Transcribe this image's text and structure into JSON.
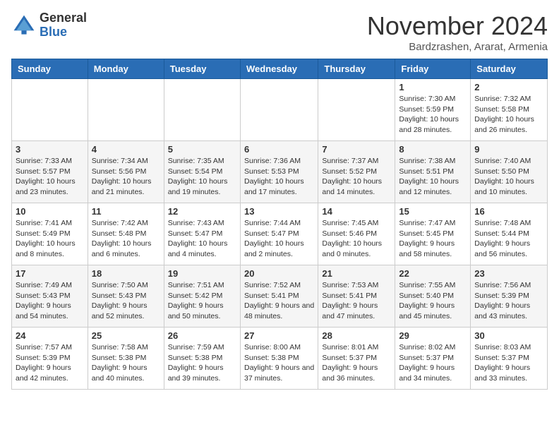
{
  "header": {
    "logo_general": "General",
    "logo_blue": "Blue",
    "month_title": "November 2024",
    "subtitle": "Bardzrashen, Ararat, Armenia"
  },
  "days_of_week": [
    "Sunday",
    "Monday",
    "Tuesday",
    "Wednesday",
    "Thursday",
    "Friday",
    "Saturday"
  ],
  "weeks": [
    [
      {
        "day": "",
        "info": ""
      },
      {
        "day": "",
        "info": ""
      },
      {
        "day": "",
        "info": ""
      },
      {
        "day": "",
        "info": ""
      },
      {
        "day": "",
        "info": ""
      },
      {
        "day": "1",
        "info": "Sunrise: 7:30 AM\nSunset: 5:59 PM\nDaylight: 10 hours and 28 minutes."
      },
      {
        "day": "2",
        "info": "Sunrise: 7:32 AM\nSunset: 5:58 PM\nDaylight: 10 hours and 26 minutes."
      }
    ],
    [
      {
        "day": "3",
        "info": "Sunrise: 7:33 AM\nSunset: 5:57 PM\nDaylight: 10 hours and 23 minutes."
      },
      {
        "day": "4",
        "info": "Sunrise: 7:34 AM\nSunset: 5:56 PM\nDaylight: 10 hours and 21 minutes."
      },
      {
        "day": "5",
        "info": "Sunrise: 7:35 AM\nSunset: 5:54 PM\nDaylight: 10 hours and 19 minutes."
      },
      {
        "day": "6",
        "info": "Sunrise: 7:36 AM\nSunset: 5:53 PM\nDaylight: 10 hours and 17 minutes."
      },
      {
        "day": "7",
        "info": "Sunrise: 7:37 AM\nSunset: 5:52 PM\nDaylight: 10 hours and 14 minutes."
      },
      {
        "day": "8",
        "info": "Sunrise: 7:38 AM\nSunset: 5:51 PM\nDaylight: 10 hours and 12 minutes."
      },
      {
        "day": "9",
        "info": "Sunrise: 7:40 AM\nSunset: 5:50 PM\nDaylight: 10 hours and 10 minutes."
      }
    ],
    [
      {
        "day": "10",
        "info": "Sunrise: 7:41 AM\nSunset: 5:49 PM\nDaylight: 10 hours and 8 minutes."
      },
      {
        "day": "11",
        "info": "Sunrise: 7:42 AM\nSunset: 5:48 PM\nDaylight: 10 hours and 6 minutes."
      },
      {
        "day": "12",
        "info": "Sunrise: 7:43 AM\nSunset: 5:47 PM\nDaylight: 10 hours and 4 minutes."
      },
      {
        "day": "13",
        "info": "Sunrise: 7:44 AM\nSunset: 5:47 PM\nDaylight: 10 hours and 2 minutes."
      },
      {
        "day": "14",
        "info": "Sunrise: 7:45 AM\nSunset: 5:46 PM\nDaylight: 10 hours and 0 minutes."
      },
      {
        "day": "15",
        "info": "Sunrise: 7:47 AM\nSunset: 5:45 PM\nDaylight: 9 hours and 58 minutes."
      },
      {
        "day": "16",
        "info": "Sunrise: 7:48 AM\nSunset: 5:44 PM\nDaylight: 9 hours and 56 minutes."
      }
    ],
    [
      {
        "day": "17",
        "info": "Sunrise: 7:49 AM\nSunset: 5:43 PM\nDaylight: 9 hours and 54 minutes."
      },
      {
        "day": "18",
        "info": "Sunrise: 7:50 AM\nSunset: 5:43 PM\nDaylight: 9 hours and 52 minutes."
      },
      {
        "day": "19",
        "info": "Sunrise: 7:51 AM\nSunset: 5:42 PM\nDaylight: 9 hours and 50 minutes."
      },
      {
        "day": "20",
        "info": "Sunrise: 7:52 AM\nSunset: 5:41 PM\nDaylight: 9 hours and 48 minutes."
      },
      {
        "day": "21",
        "info": "Sunrise: 7:53 AM\nSunset: 5:41 PM\nDaylight: 9 hours and 47 minutes."
      },
      {
        "day": "22",
        "info": "Sunrise: 7:55 AM\nSunset: 5:40 PM\nDaylight: 9 hours and 45 minutes."
      },
      {
        "day": "23",
        "info": "Sunrise: 7:56 AM\nSunset: 5:39 PM\nDaylight: 9 hours and 43 minutes."
      }
    ],
    [
      {
        "day": "24",
        "info": "Sunrise: 7:57 AM\nSunset: 5:39 PM\nDaylight: 9 hours and 42 minutes."
      },
      {
        "day": "25",
        "info": "Sunrise: 7:58 AM\nSunset: 5:38 PM\nDaylight: 9 hours and 40 minutes."
      },
      {
        "day": "26",
        "info": "Sunrise: 7:59 AM\nSunset: 5:38 PM\nDaylight: 9 hours and 39 minutes."
      },
      {
        "day": "27",
        "info": "Sunrise: 8:00 AM\nSunset: 5:38 PM\nDaylight: 9 hours and 37 minutes."
      },
      {
        "day": "28",
        "info": "Sunrise: 8:01 AM\nSunset: 5:37 PM\nDaylight: 9 hours and 36 minutes."
      },
      {
        "day": "29",
        "info": "Sunrise: 8:02 AM\nSunset: 5:37 PM\nDaylight: 9 hours and 34 minutes."
      },
      {
        "day": "30",
        "info": "Sunrise: 8:03 AM\nSunset: 5:37 PM\nDaylight: 9 hours and 33 minutes."
      }
    ]
  ]
}
